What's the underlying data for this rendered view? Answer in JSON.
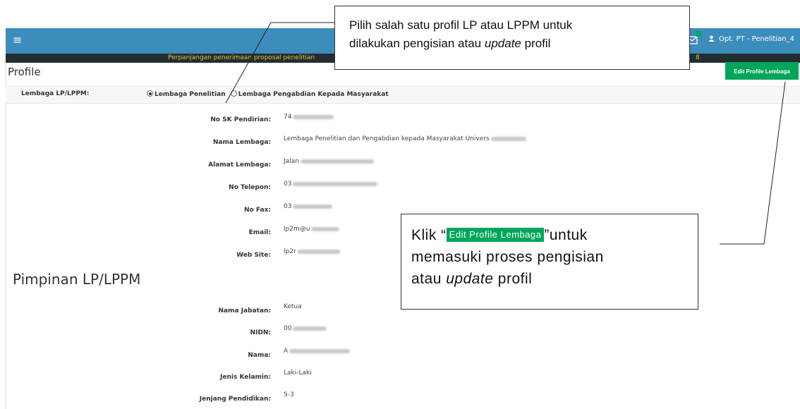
{
  "topbar": {
    "menu_icon": "hamburger-icon",
    "notification_icon": "mail-icon",
    "user_icon": "user-icon",
    "user_label": "Opt. PT - Penelitian_4"
  },
  "announcement": {
    "text": "Perpanjangan penerimaan proposal penelitian",
    "tail": "8"
  },
  "page": {
    "title": "Profile",
    "edit_button": "Edit Profile Lembaga"
  },
  "lembaga": {
    "label": "Lembaga LP/LPPM:",
    "options": [
      "Lembaga Penelitian",
      "Lembaga Pengabdian Kepada Masyarakat"
    ],
    "selected": "Lembaga Penelitian"
  },
  "profile_fields": [
    {
      "label": "No SK Pendirian:",
      "value": "74"
    },
    {
      "label": "Nama Lembaga:",
      "value": "Lembaga Penelitian dan Pengabdian kepada Masyarakat Univers"
    },
    {
      "label": "Alamat Lembaga:",
      "value": "Jalan"
    },
    {
      "label": "No Telepon:",
      "value": "03"
    },
    {
      "label": "No Fax:",
      "value": "03"
    },
    {
      "label": "Email:",
      "value": "lp2m@u"
    },
    {
      "label": "Web Site:",
      "value": "lp2r"
    }
  ],
  "pimpinan": {
    "title": "Pimpinan LP/LPPM",
    "fields": [
      {
        "label": "Nama Jabatan:",
        "value": "Ketua"
      },
      {
        "label": "NIDN:",
        "value": "00"
      },
      {
        "label": "Nama:",
        "value": "A"
      },
      {
        "label": "Jenis Kelamin:",
        "value": "Laki-Laki"
      },
      {
        "label": "Jenjang Pendidikan:",
        "value": "S-3"
      }
    ]
  },
  "callouts": {
    "top": {
      "line1": "Pilih salah satu profil LP atau LPPM untuk",
      "line2_a": "dilakukan pengisian atau ",
      "line2_em": "update",
      "line2_b": " profil"
    },
    "bottom": {
      "prefix": "Klik “",
      "button": "Edit Profile Lembaga",
      "suffix": "”untuk",
      "line2": "memasuki proses pengisian",
      "line3_a": "atau ",
      "line3_em": "update",
      "line3_b": " profil"
    }
  }
}
